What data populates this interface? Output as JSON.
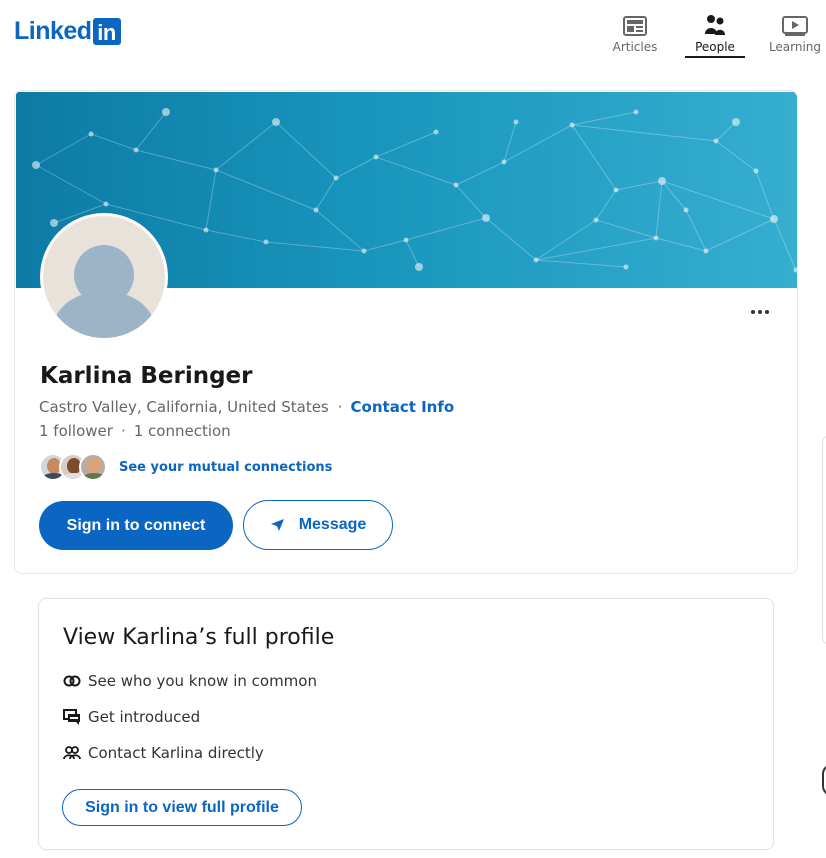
{
  "brand": {
    "logo_word": "Linked",
    "logo_box": "in",
    "color": "#0a66c2"
  },
  "nav": {
    "items": [
      {
        "label": "Articles",
        "icon": "articles-icon"
      },
      {
        "label": "People",
        "icon": "people-icon",
        "active": true
      },
      {
        "label": "Learning",
        "icon": "learning-icon"
      }
    ]
  },
  "profile": {
    "name": "Karlina Beringer",
    "location": "Castro Valley, California, United States",
    "contact_link": "Contact Info",
    "followers": "1 follower",
    "connections": "1 connection",
    "mutual_link": "See your mutual connections",
    "connect_button": "Sign in to connect",
    "message_button": "Message",
    "more_icon": "ellipsis-icon"
  },
  "full_profile": {
    "title": "View Karlina’s full profile",
    "features": [
      {
        "text": "See who you know in common",
        "icon": "interlocking-rings-icon"
      },
      {
        "text": "Get introduced",
        "icon": "speech-bubbles-icon"
      },
      {
        "text": "Contact Karlina directly",
        "icon": "people-pair-icon"
      }
    ],
    "button": "Sign in to view full profile"
  },
  "colors": {
    "accent": "#0a66c2",
    "cover_start": "#0c7ba5",
    "cover_end": "#36aed0",
    "text_primary": "#191919",
    "text_secondary": "#666666"
  }
}
